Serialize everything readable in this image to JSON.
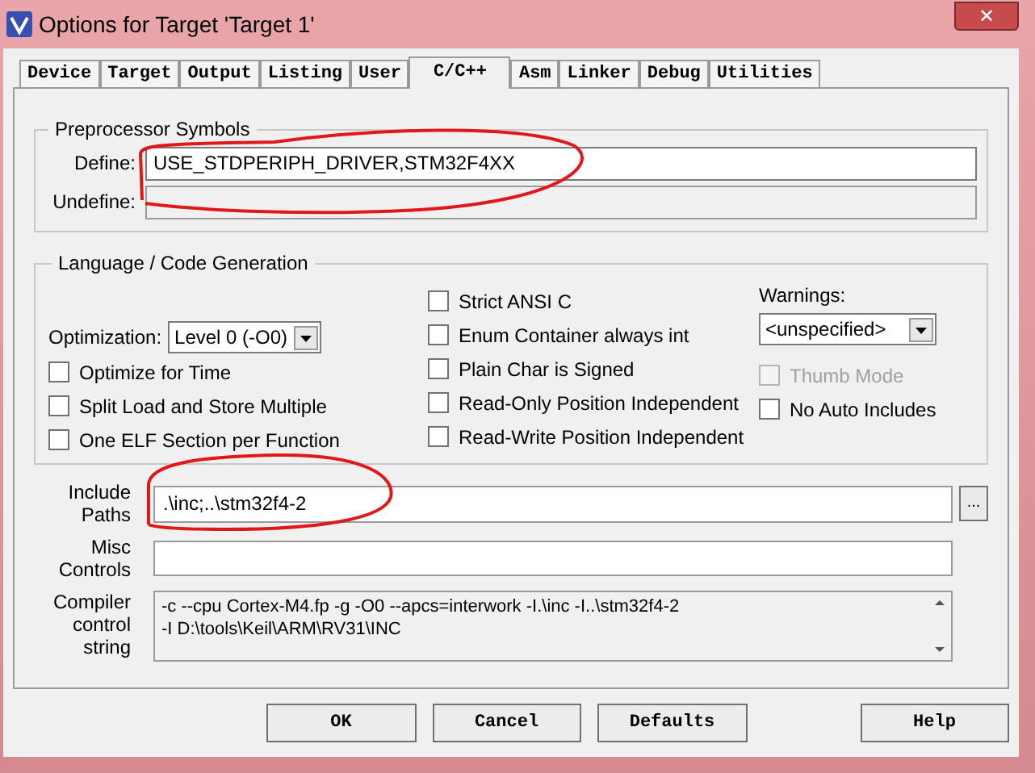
{
  "window": {
    "title": "Options for Target 'Target 1'",
    "close": "✕"
  },
  "tabs": [
    {
      "label": "Device",
      "selected": false
    },
    {
      "label": "Target",
      "selected": false
    },
    {
      "label": "Output",
      "selected": false
    },
    {
      "label": "Listing",
      "selected": false
    },
    {
      "label": "User",
      "selected": false
    },
    {
      "label": "C/C++",
      "selected": true
    },
    {
      "label": "Asm",
      "selected": false
    },
    {
      "label": "Linker",
      "selected": false
    },
    {
      "label": "Debug",
      "selected": false
    },
    {
      "label": "Utilities",
      "selected": false
    }
  ],
  "preprocessor": {
    "title": "Preprocessor Symbols",
    "define_label": "Define:",
    "define_value": "USE_STDPERIPH_DRIVER,STM32F4XX",
    "undefine_label": "Undefine:"
  },
  "language": {
    "title": "Language / Code Generation",
    "optimization_label": "Optimization:",
    "optimization_value": "Level 0 (-O0)",
    "left_options": [
      {
        "label": "Optimize for Time",
        "checked": false,
        "disabled": false
      },
      {
        "label": "Split Load and Store Multiple",
        "checked": false,
        "disabled": false
      },
      {
        "label": "One ELF Section per Function",
        "checked": false,
        "disabled": false
      }
    ],
    "middle_options": [
      {
        "label": "Strict ANSI C",
        "checked": false,
        "disabled": false
      },
      {
        "label": "Enum Container always int",
        "checked": false,
        "disabled": false
      },
      {
        "label": "Plain Char is Signed",
        "checked": false,
        "disabled": false
      },
      {
        "label": "Read-Only Position Independent",
        "checked": false,
        "disabled": false
      },
      {
        "label": "Read-Write Position Independent",
        "checked": false,
        "disabled": false
      }
    ],
    "warnings_label": "Warnings:",
    "warnings_value": "<unspecified>",
    "right_options": [
      {
        "label": "Thumb Mode",
        "checked": false,
        "disabled": true
      },
      {
        "label": "No Auto Includes",
        "checked": false,
        "disabled": false
      }
    ]
  },
  "include_paths": {
    "label_lines": [
      "Include",
      "Paths"
    ],
    "value": ".\\inc;..\\stm32f4-2",
    "browse": "..."
  },
  "misc_controls": {
    "label_lines": [
      "Misc",
      "Controls"
    ]
  },
  "compiler_string": {
    "label_lines": [
      "Compiler",
      "control",
      "string"
    ],
    "lines": [
      "-c --cpu Cortex-M4.fp -g -O0 --apcs=interwork -I.\\inc -I..\\stm32f4-2",
      "-I D:\\tools\\Keil\\ARM\\RV31\\INC"
    ]
  },
  "buttons": [
    "OK",
    "Cancel",
    "Defaults",
    "Help"
  ]
}
